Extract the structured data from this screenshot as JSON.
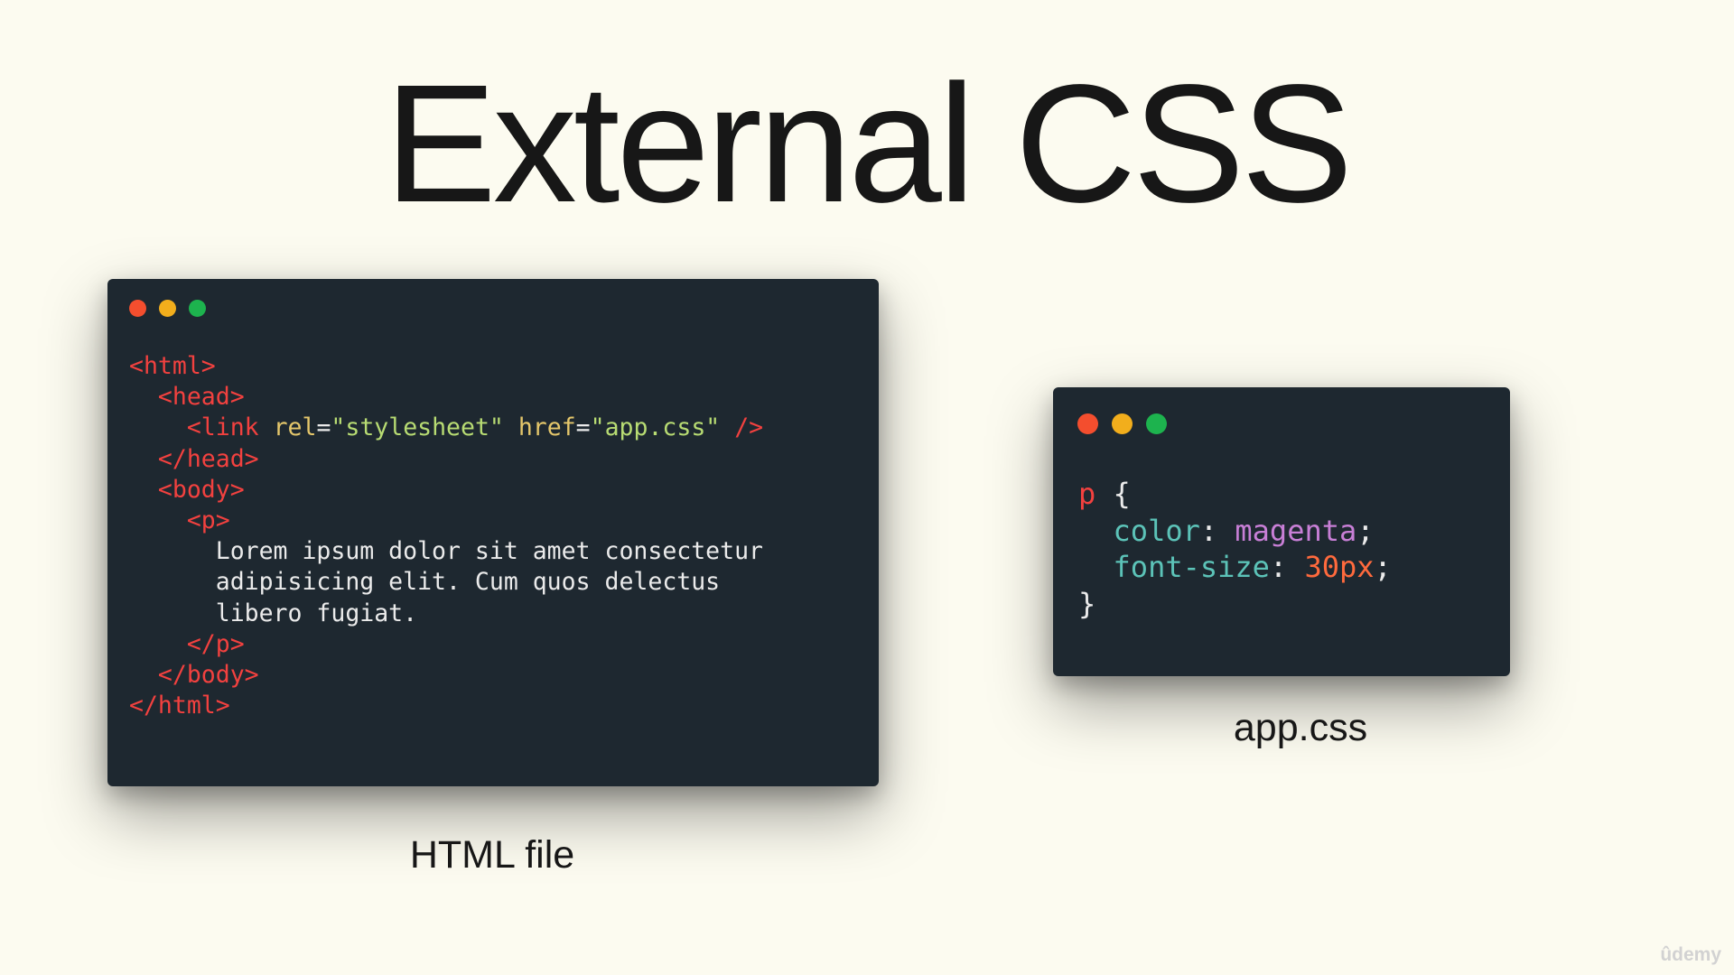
{
  "slide": {
    "title": "External CSS",
    "watermark": "ûdemy"
  },
  "colors": {
    "background": "#fcfbf0",
    "window_bg": "#1e2830",
    "dot_red": "#f44e2e",
    "dot_yellow": "#f2ae1c",
    "dot_green": "#1db34e"
  },
  "html_window": {
    "caption": "HTML file",
    "lines": {
      "l1": "<html>",
      "l2": "<head>",
      "l3_open": "<link",
      "l3_rel_attr": "rel",
      "l3_rel_val": "\"stylesheet\"",
      "l3_href_attr": "href",
      "l3_href_val": "\"app.css\"",
      "l3_close": "/>",
      "l4": "</head>",
      "l5": "<body>",
      "l6": "<p>",
      "l7": "Lorem ipsum dolor sit amet consectetur",
      "l8": "adipisicing elit. Cum quos delectus",
      "l9": "libero fugiat.",
      "l10": "</p>",
      "l11": "</body>",
      "l12": "</html>"
    }
  },
  "css_window": {
    "caption": "app.css",
    "lines": {
      "selector": "p",
      "open_brace": "{",
      "prop1": "color",
      "val1": "magenta",
      "prop2": "font-size",
      "val2": "30px",
      "close_brace": "}"
    }
  }
}
